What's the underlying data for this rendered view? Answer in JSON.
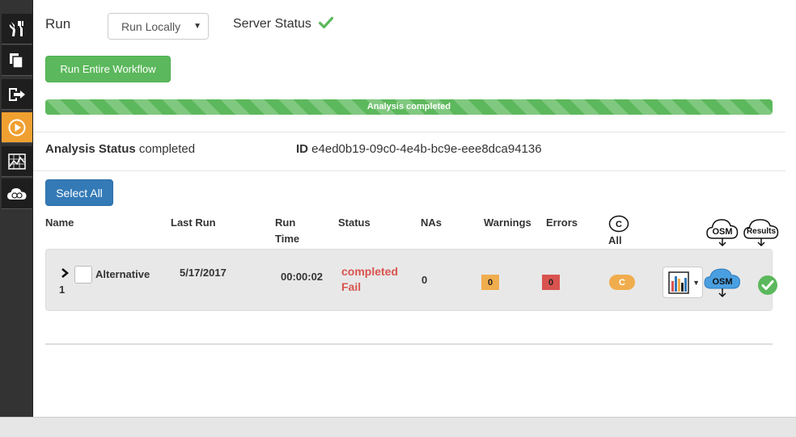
{
  "sidebar": {
    "items": [
      {
        "icon": "tools-icon"
      },
      {
        "icon": "copy-icon"
      },
      {
        "icon": "export-icon"
      },
      {
        "icon": "play-icon",
        "active": true
      },
      {
        "icon": "chart-icon"
      },
      {
        "icon": "cloud-icon"
      }
    ]
  },
  "run": {
    "label": "Run",
    "select_value": "Run Locally",
    "server_status_label": "Server Status"
  },
  "toolbar": {
    "run_workflow_label": "Run Entire Workflow",
    "select_all_label": "Select All"
  },
  "progress": {
    "label": "Analysis completed",
    "percent": 100
  },
  "analysis": {
    "status_label": "Analysis Status",
    "status_value": "completed",
    "id_label": "ID",
    "id_value": "e4ed0b19-09c0-4e4b-bc9e-eee8dca94136"
  },
  "table": {
    "headers": {
      "name": "Name",
      "last_run": "Last Run",
      "run_time_1": "Run",
      "run_time_2": "Time",
      "status": "Status",
      "nas": "NAs",
      "warnings": "Warnings",
      "errors": "Errors",
      "c_circle": "C",
      "all": "All",
      "osm": "OSM",
      "results": "Results"
    },
    "rows": [
      {
        "name_1": "Alternative",
        "name_2": "1",
        "last_run": "5/17/2017",
        "run_time": "00:00:02",
        "status_1": "completed",
        "status_2": "Fail",
        "nas": "0",
        "warnings": "0",
        "errors": "0",
        "c_badge": "C",
        "osm": "OSM"
      }
    ]
  },
  "colors": {
    "accent_green": "#5cb85c",
    "accent_blue": "#337ab7",
    "warning": "#f0ad4e",
    "danger": "#d9534f",
    "sidebar_active": "#f0a030"
  }
}
